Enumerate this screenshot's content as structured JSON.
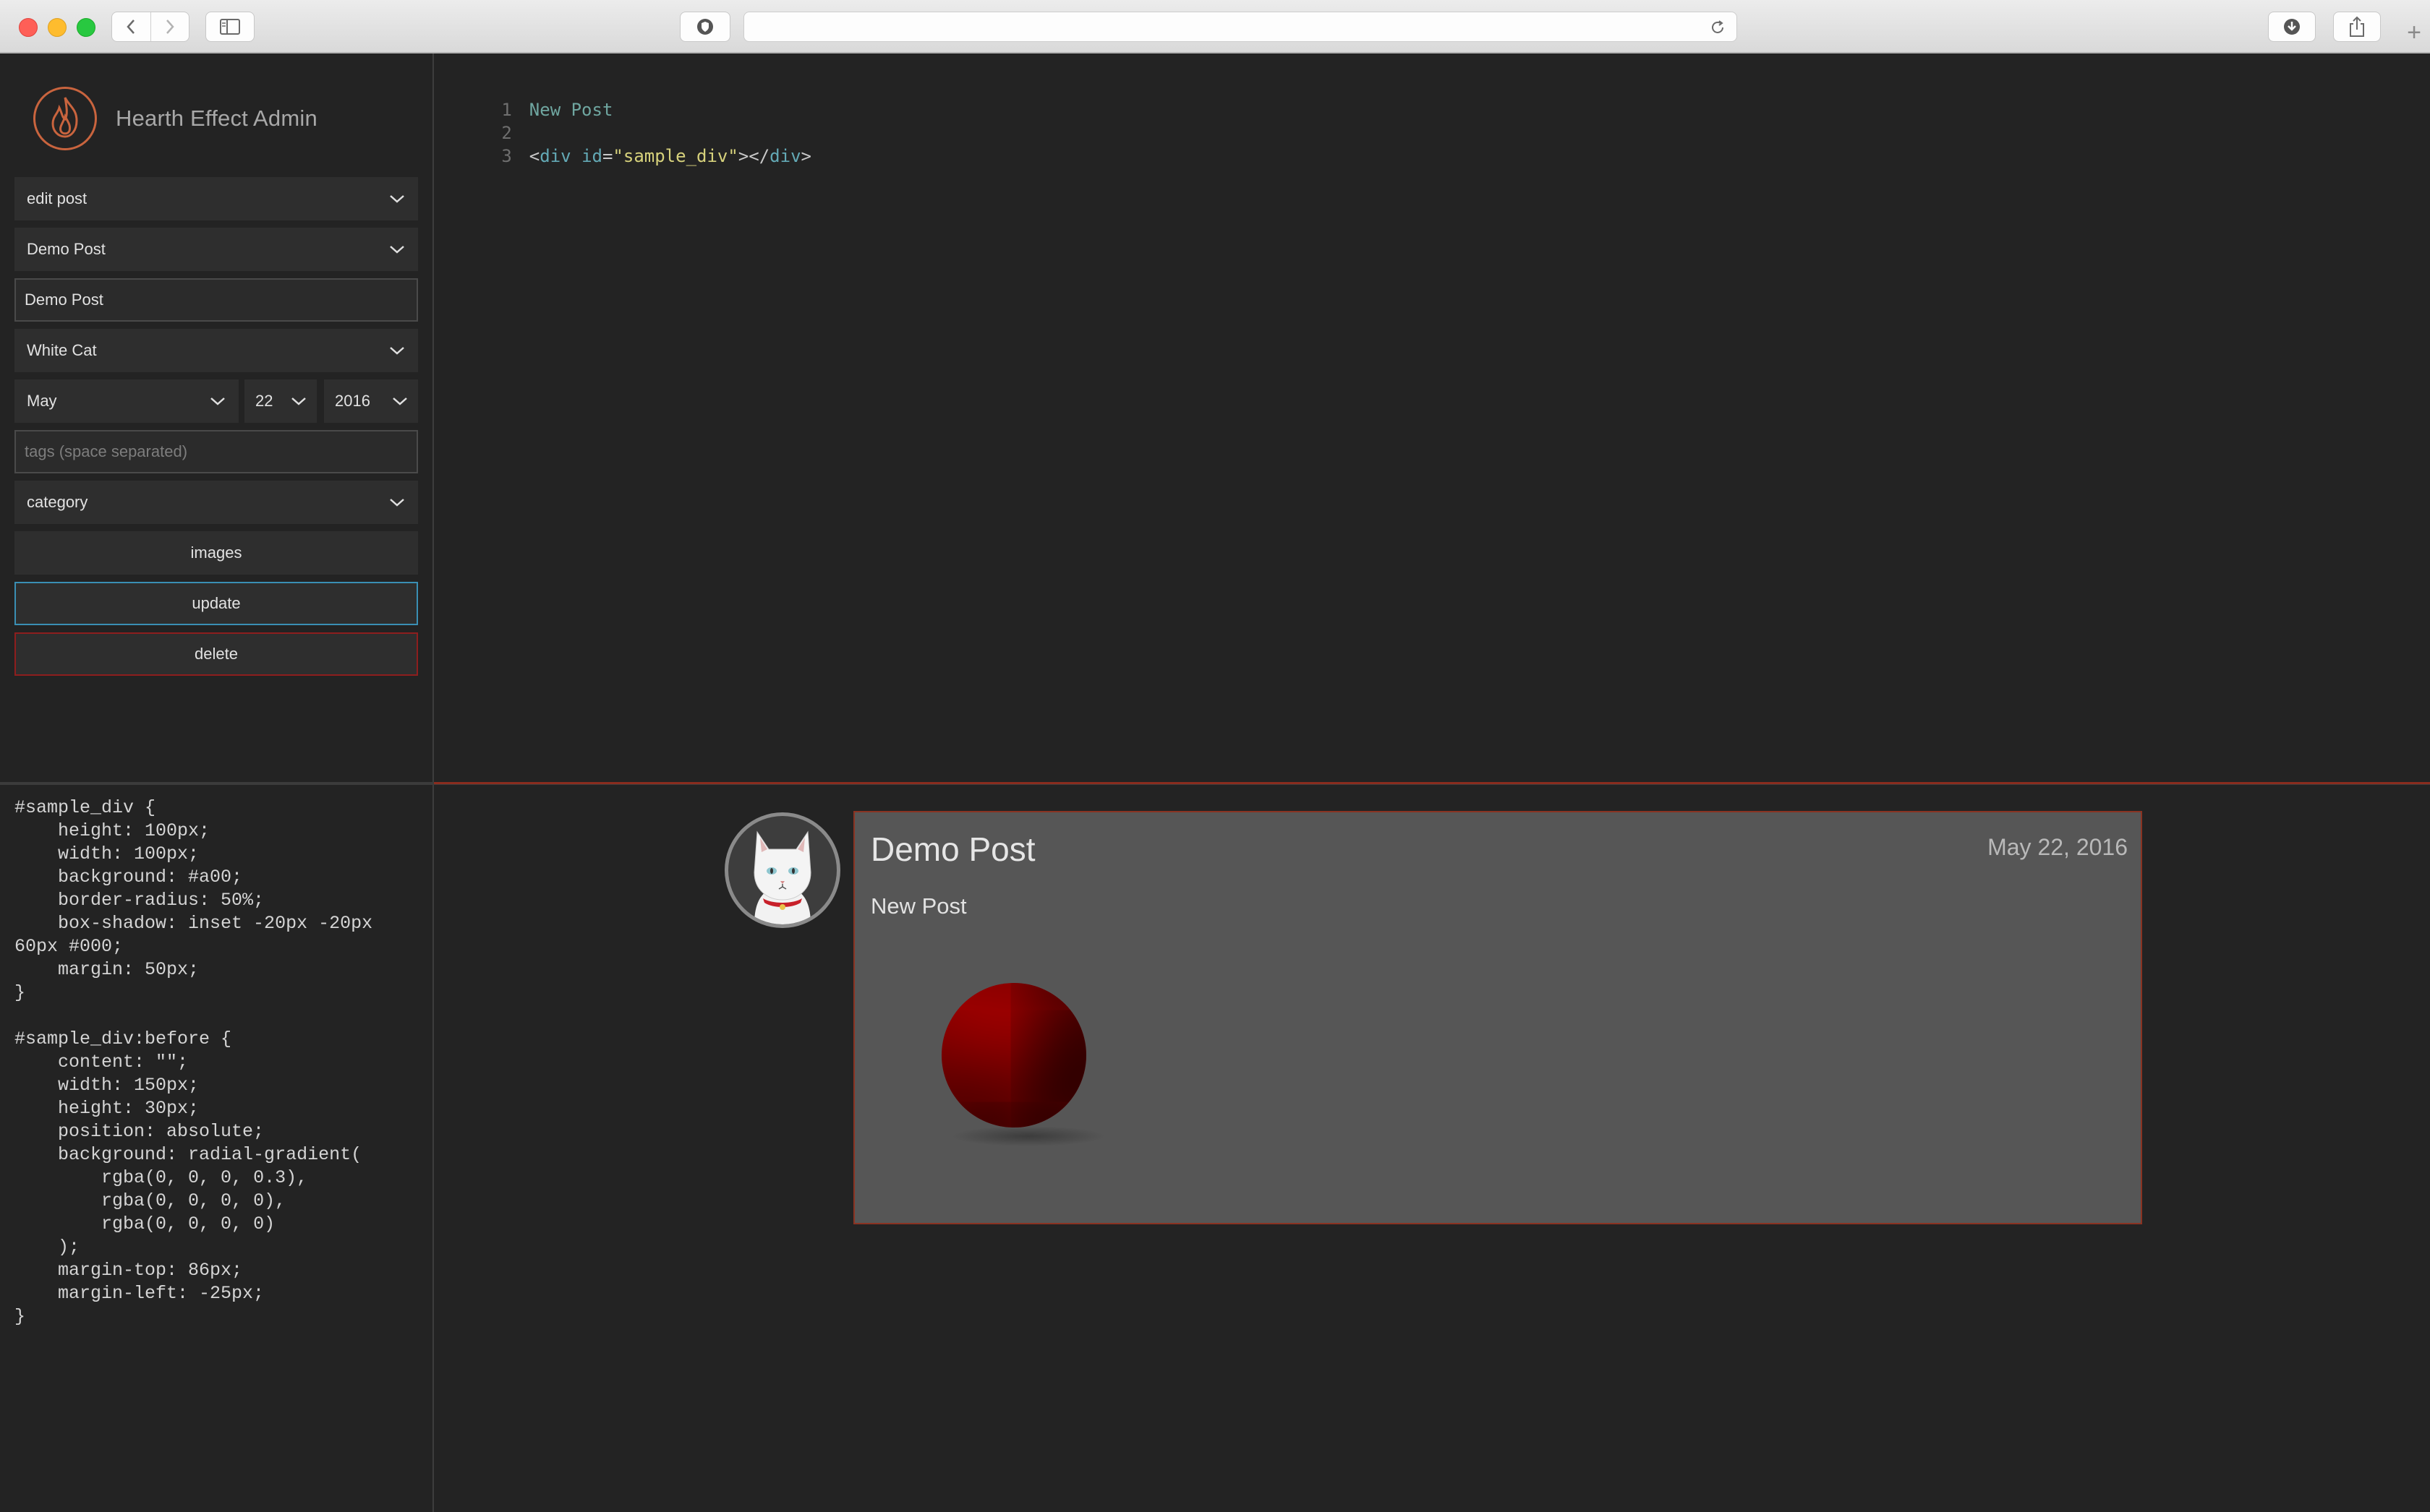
{
  "browser": {
    "traffic_lights": [
      "close",
      "minimize",
      "zoom"
    ],
    "address_value": "",
    "new_tab_label": "+"
  },
  "sidebar": {
    "app_title": "Hearth Effect Admin",
    "mode_select": "edit post",
    "post_select": "Demo Post",
    "title_input": "Demo Post",
    "author_select": "White Cat",
    "month_select": "May",
    "day_select": "22",
    "year_select": "2016",
    "tags_placeholder": "tags (space separated)",
    "category_select": "category",
    "images_button": "images",
    "update_button": "update",
    "delete_button": "delete"
  },
  "editor": {
    "line_numbers": [
      "1",
      "2",
      "3"
    ],
    "line1": "New Post",
    "line3": {
      "open_lt": "<",
      "tag": "div",
      "attr": "id",
      "eq": "=",
      "value": "\"sample_div\"",
      "close_open": "></",
      "close_tag": "div",
      "gt": ">"
    }
  },
  "css_code": "#sample_div {\n    height: 100px;\n    width: 100px;\n    background: #a00;\n    border-radius: 50%;\n    box-shadow: inset -20px -20px 60px #000;\n    margin: 50px;\n}\n\n#sample_div:before {\n    content: \"\";\n    width: 150px;\n    height: 30px;\n    position: absolute;\n    background: radial-gradient(\n        rgba(0, 0, 0, 0.3),\n        rgba(0, 0, 0, 0),\n        rgba(0, 0, 0, 0)\n    );\n    margin-top: 86px;\n    margin-left: -25px;\n}",
  "preview": {
    "post_title": "Demo Post",
    "post_date": "May 22, 2016",
    "post_body": "New Post"
  },
  "colors": {
    "accent_blue": "#3a8fb4",
    "danger_red": "#8e1e1e",
    "logo_orange": "#c9643e",
    "sphere_red": "#a00"
  }
}
